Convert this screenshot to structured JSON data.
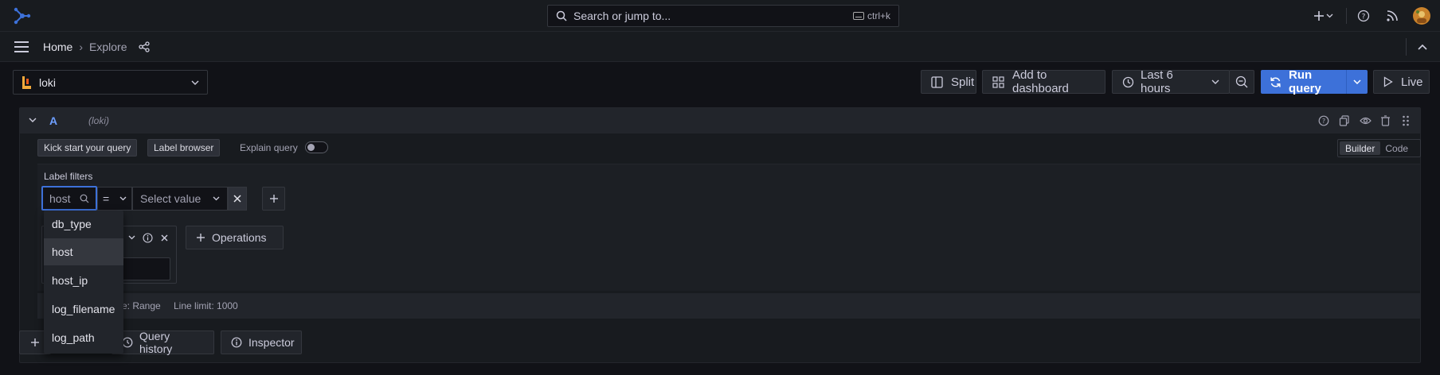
{
  "topbar": {
    "search_placeholder": "Search or jump to...",
    "shortcut": "ctrl+k"
  },
  "breadcrumb": {
    "home": "Home",
    "sep": "›",
    "current": "Explore"
  },
  "toolbar": {
    "datasource": "loki",
    "split": "Split",
    "add_to_dashboard": "Add to dashboard",
    "time_range": "Last 6 hours",
    "run_query": "Run query",
    "live": "Live"
  },
  "query": {
    "ref_id": "A",
    "datasource_label": "(loki)",
    "kick_start": "Kick start your query",
    "label_browser": "Label browser",
    "explain_query": "Explain query",
    "explain_enabled": false,
    "mode_builder": "Builder",
    "mode_code": "Code",
    "label_filters_title": "Label filters",
    "label_input_value": "host",
    "operator": "=",
    "value_placeholder": "Select value",
    "operations": "Operations",
    "options_text": "e: Range",
    "line_limit": "Line limit: 1000"
  },
  "dropdown": {
    "options": [
      "db_type",
      "host",
      "host_ip",
      "log_filename",
      "log_path"
    ],
    "highlighted": "host"
  },
  "bottom": {
    "add_icon": "plus-icon",
    "query_history": "Query history",
    "inspector": "Inspector"
  },
  "colors": {
    "background": "#111217",
    "panel": "#181b1f",
    "primary": "#3d71d9",
    "text": "#ccccdc"
  }
}
